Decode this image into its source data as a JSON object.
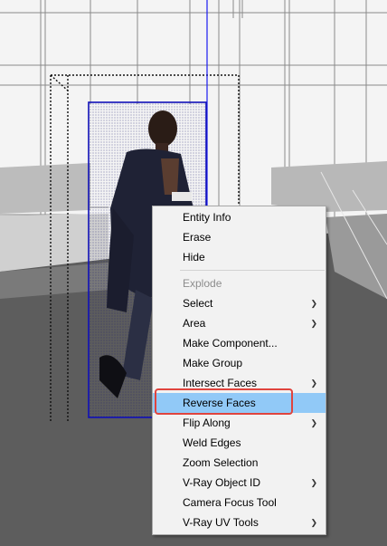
{
  "scene": {
    "selected_entity": "person-component",
    "colors": {
      "floor": "#5d5d5d",
      "wall_upper": "#f4f4f4",
      "selection_box": "#1010b8",
      "axis_blue": "#1a1af0"
    }
  },
  "context_menu": {
    "items": [
      {
        "label": "Entity Info",
        "disabled": false,
        "submenu": false
      },
      {
        "label": "Erase",
        "disabled": false,
        "submenu": false
      },
      {
        "label": "Hide",
        "disabled": false,
        "submenu": false
      },
      {
        "separator": true
      },
      {
        "label": "Explode",
        "disabled": true,
        "submenu": false
      },
      {
        "label": "Select",
        "disabled": false,
        "submenu": true
      },
      {
        "label": "Area",
        "disabled": false,
        "submenu": true
      },
      {
        "label": "Make Component...",
        "disabled": false,
        "submenu": false
      },
      {
        "label": "Make Group",
        "disabled": false,
        "submenu": false
      },
      {
        "label": "Intersect Faces",
        "disabled": false,
        "submenu": true
      },
      {
        "label": "Reverse Faces",
        "disabled": false,
        "submenu": false,
        "highlighted": true
      },
      {
        "label": "Flip Along",
        "disabled": false,
        "submenu": true
      },
      {
        "label": "Weld Edges",
        "disabled": false,
        "submenu": false
      },
      {
        "label": "Zoom Selection",
        "disabled": false,
        "submenu": false
      },
      {
        "label": "V-Ray Object ID",
        "disabled": false,
        "submenu": true
      },
      {
        "label": "Camera Focus Tool",
        "disabled": false,
        "submenu": false
      },
      {
        "label": "V-Ray UV Tools",
        "disabled": false,
        "submenu": true
      }
    ],
    "highlight_color": "#91c9f7",
    "callout_color": "#e0443e",
    "submenu_icon": "chevron-right-icon"
  }
}
